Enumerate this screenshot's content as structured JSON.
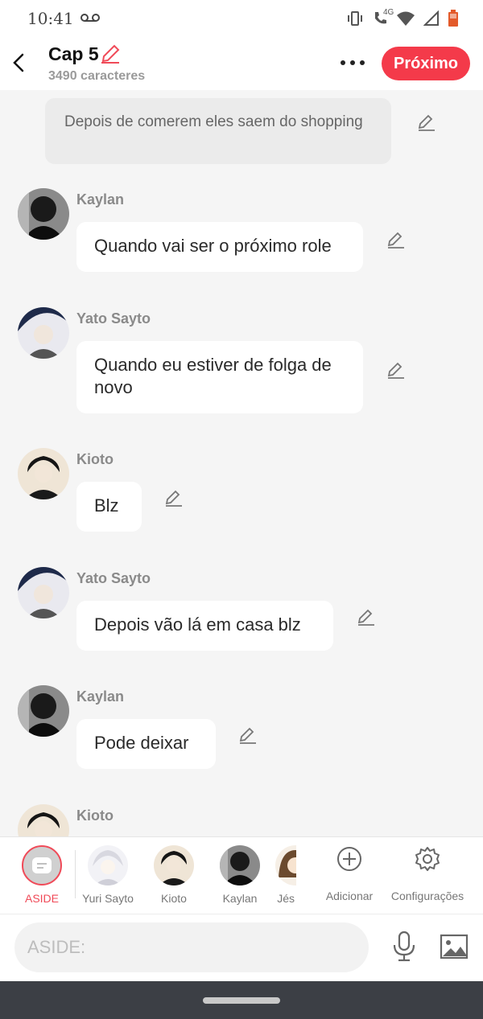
{
  "status_bar": {
    "time": "10:41",
    "network": "4G"
  },
  "header": {
    "chapter_title": "Cap 5",
    "char_count": "3490 caracteres",
    "next_label": "Próximo"
  },
  "narration": {
    "text": "Depois de comerem eles saem do shopping"
  },
  "messages": [
    {
      "sender": "Kaylan",
      "text": "Quando vai ser o próximo role"
    },
    {
      "sender": "Yato Sayto",
      "text": "Quando eu estiver de folga de novo"
    },
    {
      "sender": "Kioto",
      "text": "Blz"
    },
    {
      "sender": "Yato Sayto",
      "text": "Depois vão lá em casa blz"
    },
    {
      "sender": "Kaylan",
      "text": "Pode deixar"
    },
    {
      "sender": "Kioto",
      "text": ""
    }
  ],
  "char_bar": {
    "aside_label": "ASIDE",
    "characters": [
      {
        "name": "Yuri Sayto"
      },
      {
        "name": "Kioto"
      },
      {
        "name": "Kaylan"
      },
      {
        "name": "Jés"
      }
    ],
    "add_label": "Adicionar",
    "settings_label": "Configurações"
  },
  "input": {
    "placeholder": "ASIDE:"
  },
  "colors": {
    "accent": "#f43a4a",
    "background": "#f5f5f5",
    "bubble": "#ffffff",
    "nav": "#3c3f45"
  }
}
